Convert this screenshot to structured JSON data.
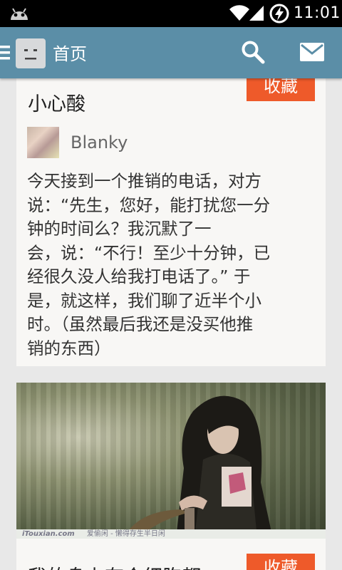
{
  "status_bar": {
    "time": "11:01",
    "icons": [
      "android-icon",
      "wifi-icon",
      "signal-icon",
      "battery-charging-icon"
    ]
  },
  "action_bar": {
    "title": "首页",
    "icons": [
      "menu-icon",
      "app-logo-icon",
      "search-icon",
      "mail-icon"
    ]
  },
  "posts": [
    {
      "title": "小心酸",
      "favorite_label": "收藏",
      "author": "Blanky",
      "body_lines": [
        "今天接到一个推销的电话，对方",
        "说：“先生，您好，能打扰您一分",
        "钟的时间么？我沉默了一",
        "会，说：“不行！至少十分钟，已",
        "经很久没人给我打电话了。” 于",
        "是，就这样，我们聊了近半个小",
        "时。（虽然最后我还是没买他推",
        "销的东西）"
      ]
    },
    {
      "image_caption_brand": "iTouxian.com",
      "image_caption_text": "爱偷闲 - 懒得存生半日闲",
      "title": "我的身上有个细胞都",
      "favorite_label": "收藏"
    }
  ],
  "colors": {
    "action_bar": "#5b8ea7",
    "favorite_button": "#ee5a2a",
    "card_background": "#f8f7f5",
    "page_background": "#e8e8e8"
  }
}
